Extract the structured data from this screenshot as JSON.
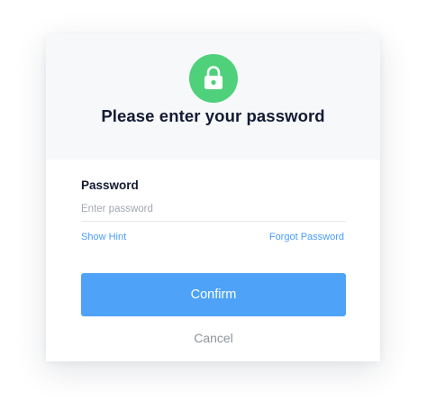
{
  "dialog": {
    "title": "Please enter your password",
    "icon": "lock-icon",
    "icon_bg_color": "#4ed17a"
  },
  "form": {
    "password_label": "Password",
    "password_placeholder": "Enter password",
    "password_value": ""
  },
  "links": {
    "show_hint": "Show Hint",
    "forgot_password": "Forgot Password",
    "color": "#4a9df8"
  },
  "actions": {
    "confirm_label": "Confirm",
    "confirm_color": "#4ea3f8",
    "cancel_label": "Cancel"
  }
}
